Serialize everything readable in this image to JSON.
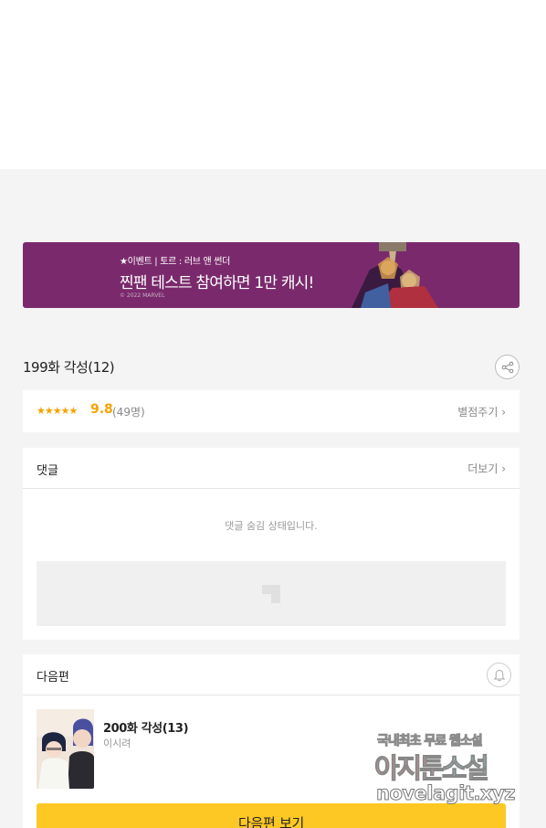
{
  "banner": {
    "small_text": "★이벤트 | 토르 : 러브 앤 썬더",
    "big_text": "찐팬 테스트 참여하면 1만 캐시!",
    "copyright": "© 2022 MARVEL"
  },
  "episode": {
    "title": "199화 각성(12)",
    "stars": "★★★★★",
    "score": "9.8",
    "count": "(49명)",
    "rate_link": "별점주기 ›"
  },
  "comments": {
    "title": "댓글",
    "more": "더보기 ›",
    "hidden_message": "댓글 숨김 상태입니다."
  },
  "next": {
    "section_title": "다음편",
    "episode_title": "200화 각성(13)",
    "author": "이시려",
    "button_label": "다음편 보기"
  },
  "watermark": {
    "line1_a": "국내최초 무료 ",
    "line1_b": "웹소설",
    "line2_a": "아지툰",
    "line2_b": "소설",
    "line3": "novelagit.xyz"
  },
  "colors": {
    "banner_bg": "#7a2a6c",
    "accent_star": "#f5a300",
    "next_button": "#fdc823"
  }
}
